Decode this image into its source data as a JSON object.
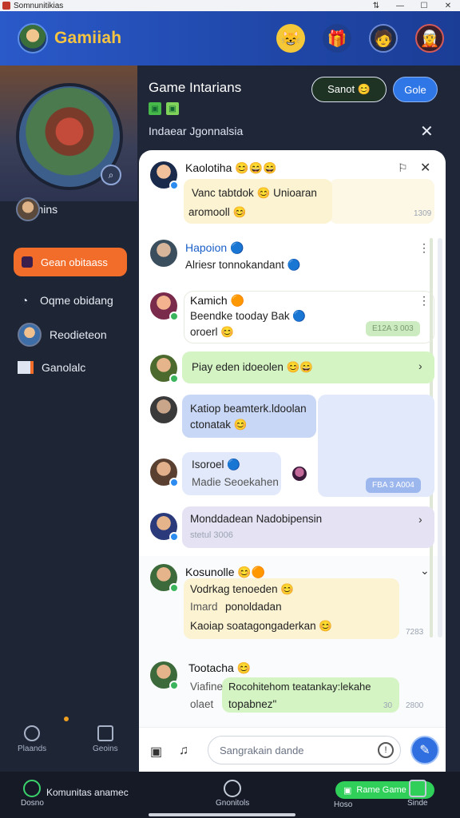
{
  "window": {
    "title": "Somnunitikias",
    "controls": [
      "⇅",
      "—",
      "☐",
      "✕"
    ]
  },
  "app": {
    "brand": "Gamiiah",
    "header_icons": [
      "emoji-avatar-icon",
      "gift-icon",
      "profile-avatar-icon",
      "profile-avatar-2-icon"
    ]
  },
  "sidebar": {
    "user_name": "Gtomins",
    "active_item": "Gean obitaass",
    "items": [
      {
        "label": "Oqme obidang",
        "icon": "clock-icon"
      },
      {
        "label": "Reodieteon",
        "icon": "avatar"
      },
      {
        "label": "Ganolalc",
        "icon": "bars-icon"
      }
    ],
    "footer": [
      {
        "label": "Plaands"
      },
      {
        "label": "Geoins"
      }
    ]
  },
  "panel": {
    "title": "Game Intarians",
    "subtitle": "Indaear Jgonnalsia",
    "button_dark": "Sanot 😊",
    "button_blue": "Gole",
    "badges": [
      "▣",
      "▣"
    ]
  },
  "chat": {
    "messages": [
      {
        "name": "Kaolotiha 😊😄😄",
        "text1": "Vanc tabtdok 😊 Unioaran",
        "text2": "aromooll 😊",
        "time": "1309"
      },
      {
        "name": "Hapoion 🔵",
        "text1": "Alriesr tonnokandant 🔵"
      },
      {
        "name": "Kamich 🟠",
        "text1": "Beendke tooday Bak 🔵",
        "text2": "oroerl 😊",
        "chip": "E12A 3 003"
      },
      {
        "name": "",
        "text1": "Piay eden idoeolen 😊😄"
      },
      {
        "name": "",
        "text1": "Katiop beamterk.ldoolan",
        "text2": "ctonatak 😊"
      },
      {
        "name": "Isoroel 🔵",
        "text1": "Madie Seoekahen",
        "chip": "FBA 3 A004"
      },
      {
        "name": "",
        "text1": "Monddadean Nadobipensin",
        "text2": "stetul 3006"
      },
      {
        "name": "Kosunolle 😊🟠",
        "text1": "Vodrkag tenoeden 😊",
        "text2": "Imard",
        "text3": "ponoldadan",
        "text4": "Kaoiap soatagongaderkan 😊",
        "time": "7283"
      },
      {
        "name": "Tootacha 😊",
        "text1": "Viafine",
        "text2": "Rocohitehom teatankay:lekahe",
        "text3": "olaet",
        "text4": "topabnez\"",
        "time": "2800",
        "small": "30"
      }
    ],
    "input_placeholder": "Sangrakain dande"
  },
  "bottom_nav": {
    "title": "Komunitas anamec",
    "items": [
      {
        "label": "Dosno"
      },
      {
        "label": "Gnonitols"
      },
      {
        "label": "Hoso"
      },
      {
        "label": "Sinde"
      }
    ],
    "pill": "Rame Game"
  }
}
